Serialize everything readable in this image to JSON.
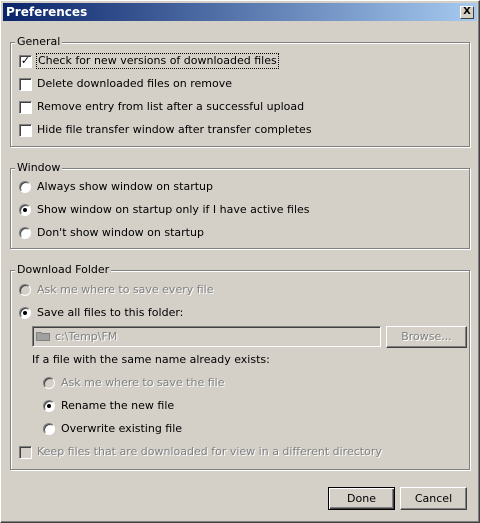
{
  "window": {
    "title": "Preferences",
    "close_label": "X"
  },
  "general": {
    "legend": "General",
    "items": [
      {
        "label": "Check for new versions of downloaded files",
        "checked": true
      },
      {
        "label": "Delete downloaded files on remove",
        "checked": false
      },
      {
        "label": "Remove entry from list after a successful upload",
        "checked": false
      },
      {
        "label": "Hide file transfer window after transfer completes",
        "checked": false
      }
    ]
  },
  "window_group": {
    "legend": "Window",
    "options": [
      {
        "label": "Always show window on startup",
        "selected": false
      },
      {
        "label": "Show window on startup only if I have active files",
        "selected": true
      },
      {
        "label": "Don't show window on startup",
        "selected": false
      }
    ]
  },
  "download_folder": {
    "legend": "Download Folder",
    "ask_label": "Ask me where to save every file",
    "save_all_label": "Save all files to this folder:",
    "folder_path": "c:\\Temp\\FM",
    "browse_label": "Browse...",
    "same_name_prompt": "If a file with the same name already exists:",
    "same_name_options": [
      {
        "label": "Ask me where to save the file",
        "selected": false,
        "enabled": false
      },
      {
        "label": "Rename the new file",
        "selected": true,
        "enabled": true
      },
      {
        "label": "Overwrite existing file",
        "selected": false,
        "enabled": true
      }
    ],
    "keep_files_label": "Keep files that are downloaded for view in a different directory"
  },
  "footer": {
    "done_label": "Done",
    "cancel_label": "Cancel"
  }
}
